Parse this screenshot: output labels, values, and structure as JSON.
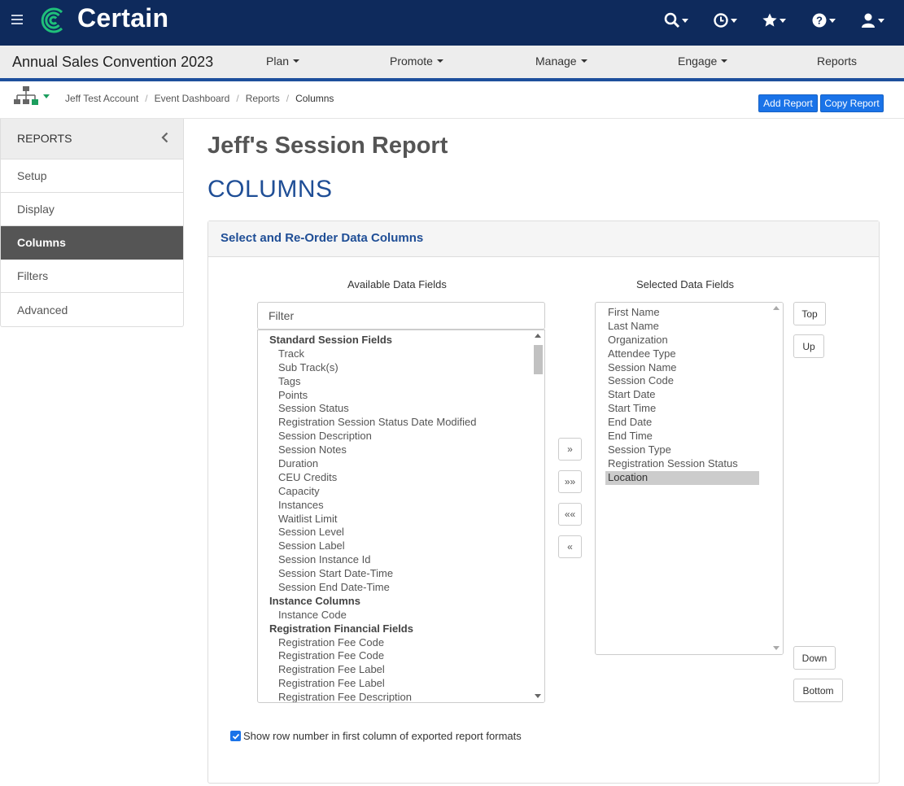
{
  "app": {
    "name": "Certain",
    "event_title": "Annual Sales Convention 2023"
  },
  "topbar_icons": [
    "search-icon",
    "history-icon",
    "star-icon",
    "help-icon",
    "user-icon"
  ],
  "nav": {
    "plan": "Plan",
    "promote": "Promote",
    "manage": "Manage",
    "engage": "Engage",
    "reports": "Reports"
  },
  "breadcrumb": {
    "account": "Jeff Test Account",
    "dashboard": "Event Dashboard",
    "reports": "Reports",
    "current": "Columns"
  },
  "actions": {
    "add_report": "Add Report",
    "copy_report": "Copy Report"
  },
  "sidebar": {
    "title": "REPORTS",
    "items": [
      {
        "label": "Setup",
        "active": false
      },
      {
        "label": "Display",
        "active": false
      },
      {
        "label": "Columns",
        "active": true
      },
      {
        "label": "Filters",
        "active": false
      },
      {
        "label": "Advanced",
        "active": false
      }
    ]
  },
  "main": {
    "report_title": "Jeff's Session Report",
    "section_title": "COLUMNS",
    "panel_title": "Select and Re-Order Data Columns",
    "available_label": "Available Data Fields",
    "selected_label": "Selected Data Fields",
    "filter_placeholder": "Filter"
  },
  "available_fields": [
    {
      "text": "Standard Session Fields",
      "group": true
    },
    {
      "text": "Track"
    },
    {
      "text": "Sub Track(s)"
    },
    {
      "text": "Tags"
    },
    {
      "text": "Points"
    },
    {
      "text": "Session Status"
    },
    {
      "text": "Registration Session Status Date Modified"
    },
    {
      "text": "Session Description"
    },
    {
      "text": "Session Notes"
    },
    {
      "text": "Duration"
    },
    {
      "text": "CEU Credits"
    },
    {
      "text": "Capacity"
    },
    {
      "text": "Instances"
    },
    {
      "text": "Waitlist Limit"
    },
    {
      "text": "Session Level"
    },
    {
      "text": "Session Label"
    },
    {
      "text": "Session Instance Id"
    },
    {
      "text": "Session Start Date-Time"
    },
    {
      "text": "Session End Date-Time"
    },
    {
      "text": "Instance Columns",
      "group": true
    },
    {
      "text": "Instance Code"
    },
    {
      "text": "Registration Financial Fields",
      "group": true
    },
    {
      "text": "Registration Fee Code"
    },
    {
      "text": "Registration Fee Code"
    },
    {
      "text": "Registration Fee Label"
    },
    {
      "text": "Registration Fee Label"
    },
    {
      "text": "Registration Fee Description"
    }
  ],
  "selected_fields": [
    {
      "text": "First Name"
    },
    {
      "text": "Last Name"
    },
    {
      "text": "Organization"
    },
    {
      "text": "Attendee Type"
    },
    {
      "text": "Session Name"
    },
    {
      "text": "Session Code"
    },
    {
      "text": "Start Date"
    },
    {
      "text": "Start Time"
    },
    {
      "text": "End Date"
    },
    {
      "text": "End Time"
    },
    {
      "text": "Session Type"
    },
    {
      "text": "Registration Session Status"
    },
    {
      "text": "Location",
      "selected": true
    }
  ],
  "move_buttons": {
    "add": "»",
    "add_all": "»»",
    "remove_all": "««",
    "remove": "«"
  },
  "order_buttons": {
    "top": "Top",
    "up": "Up",
    "down": "Down",
    "bottom": "Bottom"
  },
  "options": {
    "show_row_number": "Show row number in first column of exported report formats",
    "show_row_number_checked": true
  },
  "colors": {
    "header_bg": "#0e2a5c",
    "brand_green": "#1fc07a",
    "accent_blue": "#1f4e96",
    "button_blue": "#1a73e8"
  }
}
